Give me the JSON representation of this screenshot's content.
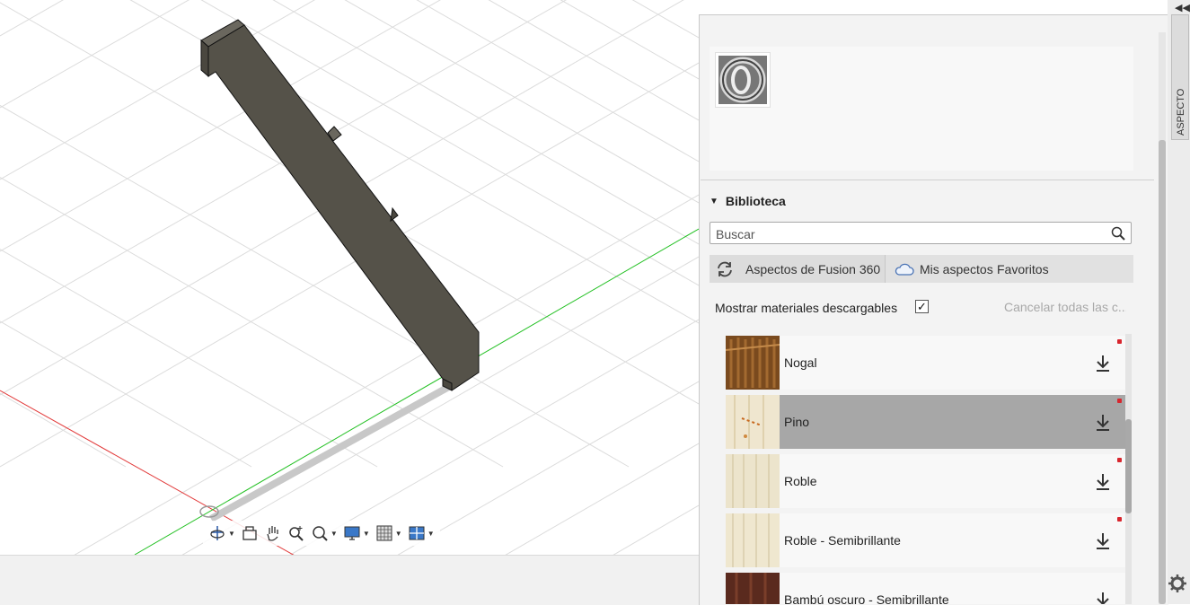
{
  "panel": {
    "library_title": "Biblioteca",
    "search": {
      "placeholder": "Buscar",
      "value": ""
    },
    "tabs": [
      {
        "label": "Aspectos de Fusion 360",
        "icon": "refresh-icon"
      },
      {
        "label": "Mis aspectos",
        "icon": "cloud-icon"
      },
      {
        "label": "Favoritos"
      }
    ],
    "show_downloadable_label": "Mostrar materiales descargables",
    "show_downloadable_checked": true,
    "check_mark": "✓",
    "cancel_all_label": "Cancelar todas las c...",
    "materials": [
      {
        "name": "Nogal",
        "selected": false,
        "has_new_dot": true
      },
      {
        "name": "Pino",
        "selected": true,
        "has_new_dot": true
      },
      {
        "name": "Roble",
        "selected": false,
        "has_new_dot": true
      },
      {
        "name": "Roble - Semibrillante",
        "selected": false,
        "has_new_dot": true
      },
      {
        "name": "Bambú oscuro - Semibrillante",
        "selected": false,
        "has_new_dot": false
      }
    ]
  },
  "side_tab": {
    "label": "ASPECTO",
    "collapse_glyph": "◀◀"
  },
  "colors": {
    "model_body": "#555249",
    "axis_x": "#e23b3b",
    "axis_y": "#22c022",
    "selected_row": "#a7a7a7",
    "new_dot": "#d8262e"
  }
}
